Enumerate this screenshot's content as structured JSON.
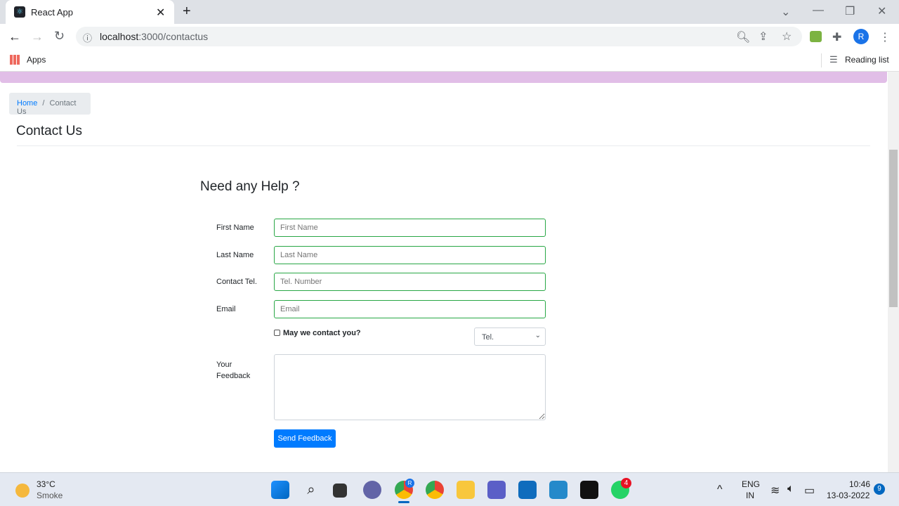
{
  "browser": {
    "tab_title": "React App",
    "url_host": "localhost",
    "url_path": ":3000/contactus",
    "apps_label": "Apps",
    "reading_list": "Reading list",
    "profile_initial": "R"
  },
  "breadcrumb": {
    "home": "Home",
    "separator": "/",
    "current": "Contact Us"
  },
  "page": {
    "title": "Contact Us",
    "subtitle": "Need any Help ?"
  },
  "form": {
    "first_name": {
      "label": "First Name",
      "placeholder": "First Name"
    },
    "last_name": {
      "label": "Last Name",
      "placeholder": "Last Name"
    },
    "tel": {
      "label": "Contact Tel.",
      "placeholder": "Tel. Number"
    },
    "email": {
      "label": "Email",
      "placeholder": "Email"
    },
    "contact_checkbox": {
      "label": "May we contact you?",
      "checked": false
    },
    "contact_type": {
      "selected": "Tel."
    },
    "feedback": {
      "label_line1": "Your",
      "label_line2": "Feedback"
    },
    "submit": "Send Feedback"
  },
  "colors": {
    "navbar": "#e1bee7",
    "accent": "#007bff",
    "valid_border": "#28a745"
  },
  "taskbar": {
    "weather_temp": "33°C",
    "weather_desc": "Smoke",
    "lang1": "ENG",
    "lang2": "IN",
    "time": "10:46",
    "date": "13-03-2022",
    "notifications": "9",
    "whatsapp_badge": "4",
    "chrome_badge": "R"
  }
}
